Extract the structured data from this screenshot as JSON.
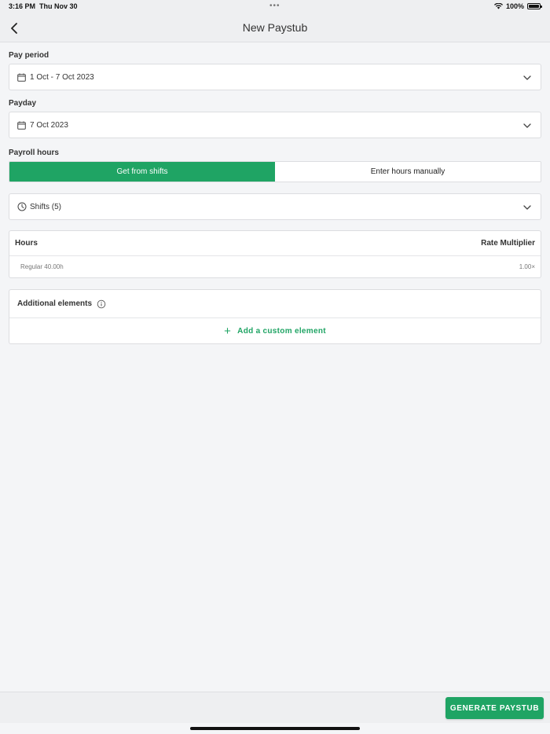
{
  "status_bar": {
    "time": "3:16 PM",
    "date": "Thu Nov 30",
    "battery": "100%",
    "dots": "•••"
  },
  "nav": {
    "title": "New Paystub",
    "back_icon": "chevron-left-icon"
  },
  "pay_period": {
    "label": "Pay period",
    "value": "1 Oct - 7 Oct 2023",
    "icon": "calendar-icon"
  },
  "payday": {
    "label": "Payday",
    "value": "7 Oct 2023",
    "icon": "calendar-icon"
  },
  "payroll_hours": {
    "label": "Payroll hours",
    "options": [
      "Get from shifts",
      "Enter hours manually"
    ],
    "selected": "Get from shifts"
  },
  "shifts": {
    "value": "Shifts (5)",
    "icon": "clock-icon"
  },
  "hours_table": {
    "columns": [
      "Hours",
      "Rate Multiplier"
    ],
    "rows": [
      {
        "hours": "Regular 40.00h",
        "multiplier": "1.00×"
      }
    ]
  },
  "additional_elements": {
    "title": "Additional elements",
    "info_icon": "info-icon",
    "add_label": "Add a custom element",
    "add_icon": "plus-icon"
  },
  "footer": {
    "generate_label": "GENERATE PAYSTUB"
  },
  "colors": {
    "accent": "#1fa464",
    "background": "#f4f5f7",
    "bar": "#eeeff1"
  }
}
